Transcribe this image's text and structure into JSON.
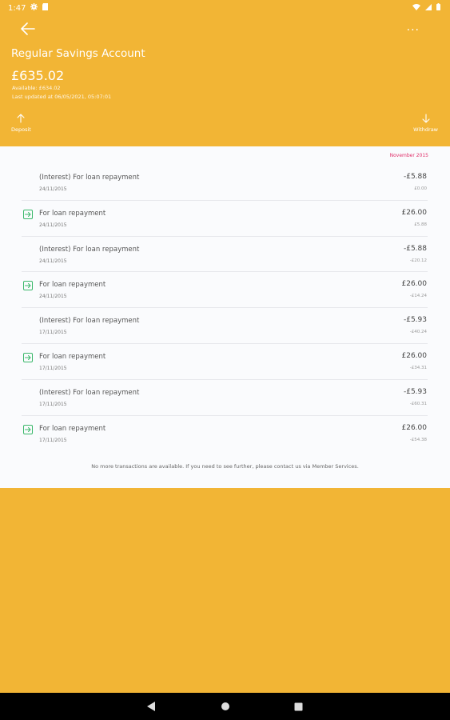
{
  "status_bar": {
    "time": "1:47"
  },
  "header": {
    "title": "Regular Savings Account",
    "balance": "£635.02",
    "available": "Available: £634.02",
    "last_updated": "Last updated at 06/05/2021, 05:07:01",
    "deposit_label": "Deposit",
    "withdraw_label": "Withdraw",
    "more_label": "···"
  },
  "month_label": "November 2015",
  "transactions": [
    {
      "desc": "(Interest) For loan repayment",
      "date": "24/11/2015",
      "amount": "-£5.88",
      "running": "£0.00",
      "icon": false
    },
    {
      "desc": "For loan repayment",
      "date": "24/11/2015",
      "amount": "£26.00",
      "running": "£5.88",
      "icon": true
    },
    {
      "desc": "(Interest) For loan repayment",
      "date": "24/11/2015",
      "amount": "-£5.88",
      "running": "-£20.12",
      "icon": false
    },
    {
      "desc": "For loan repayment",
      "date": "24/11/2015",
      "amount": "£26.00",
      "running": "-£14.24",
      "icon": true
    },
    {
      "desc": "(Interest) For loan repayment",
      "date": "17/11/2015",
      "amount": "-£5.93",
      "running": "-£40.24",
      "icon": false
    },
    {
      "desc": "For loan repayment",
      "date": "17/11/2015",
      "amount": "£26.00",
      "running": "-£34.31",
      "icon": true
    },
    {
      "desc": "(Interest) For loan repayment",
      "date": "17/11/2015",
      "amount": "-£5.93",
      "running": "-£60.31",
      "icon": false
    },
    {
      "desc": "For loan repayment",
      "date": "17/11/2015",
      "amount": "£26.00",
      "running": "-£54.38",
      "icon": true
    }
  ],
  "no_more_text": "No more transactions are available. If you need to see further, please contact us via Member Services.",
  "colors": {
    "brand": "#F2B535",
    "accent_month": "#E0306A",
    "icon_green": "#3BB86A"
  }
}
